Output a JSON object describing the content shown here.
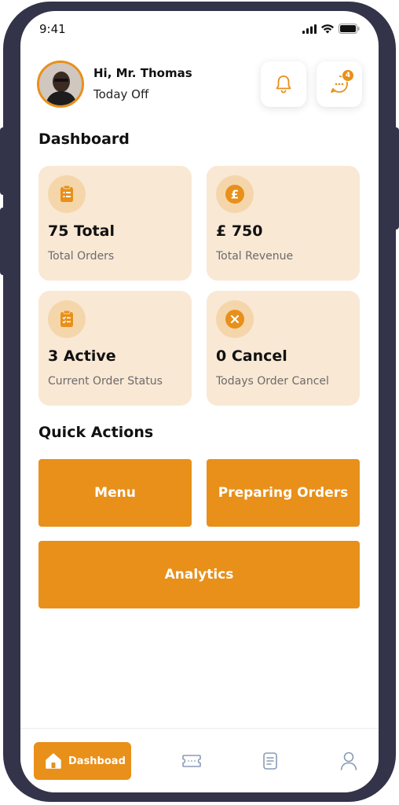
{
  "status_bar": {
    "time": "9:41"
  },
  "header": {
    "greeting": "Hi, Mr. Thomas",
    "status": "Today Off",
    "chat_badge": "4"
  },
  "dashboard": {
    "title": "Dashboard",
    "cards": [
      {
        "value": "75 Total",
        "label": "Total Orders",
        "icon": "clipboard-list-icon"
      },
      {
        "value": "£ 750",
        "label": "Total Revenue",
        "icon": "pound-coin-icon"
      },
      {
        "value": "3 Active",
        "label": "Current Order Status",
        "icon": "clipboard-check-icon"
      },
      {
        "value": "0 Cancel",
        "label": "Todays Order Cancel",
        "icon": "cancel-circle-icon"
      }
    ]
  },
  "quick_actions": {
    "title": "Quick Actions",
    "menu": "Menu",
    "preparing_orders": "Preparing Orders",
    "analytics": "Analytics"
  },
  "bottom_nav": {
    "active_label": "Dashboad",
    "items": [
      "home-icon",
      "ticket-icon",
      "document-icon",
      "user-icon"
    ]
  },
  "colors": {
    "accent": "#e8901a",
    "card_bg": "#f9e8d4",
    "frame": "#33334a"
  }
}
